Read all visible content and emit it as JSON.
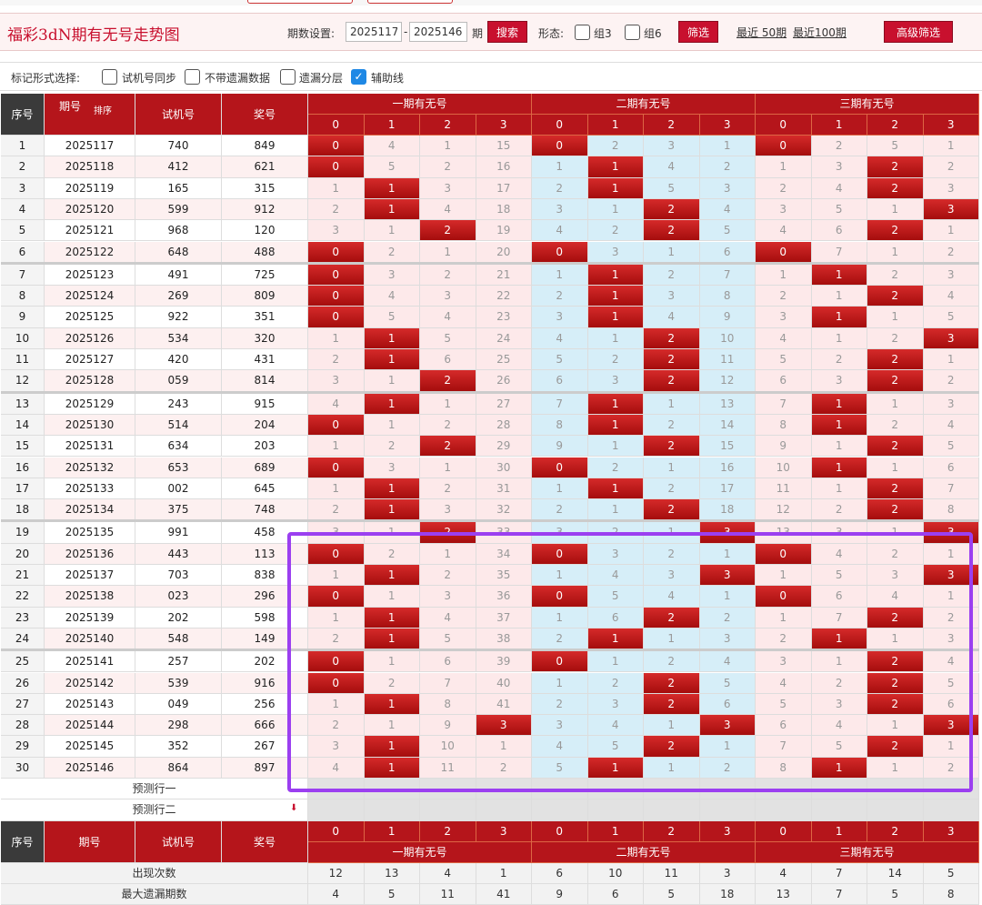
{
  "header": {
    "title": "福彩3dN期有无号走势图",
    "period_setting_label": "期数设置:",
    "period_from": "2025117",
    "period_dash": "-",
    "period_to": "2025146",
    "period_unit": "期",
    "search_button": "搜索",
    "form_label": "形态:",
    "group3_label": "组3",
    "group6_label": "组6",
    "filter_button": "筛选",
    "recent50": "最近 50期",
    "recent100": "最近100期",
    "advanced_button": "高级筛选"
  },
  "mark_options": {
    "label": "标记形式选择:",
    "items": [
      {
        "label": "试机号同步",
        "checked": false
      },
      {
        "label": "不带遗漏数据",
        "checked": false
      },
      {
        "label": "遗漏分层",
        "checked": false
      },
      {
        "label": "辅助线",
        "checked": true
      }
    ]
  },
  "table_header": {
    "seq": "序号",
    "period": "期号",
    "sort": "排序",
    "trial": "试机号",
    "prize": "奖号",
    "groups": [
      "一期有无号",
      "二期有无号",
      "三期有无号"
    ],
    "digits": [
      "0",
      "1",
      "2",
      "3"
    ]
  },
  "rows": [
    {
      "seq": "1",
      "period": "2025117",
      "trial": "740",
      "prize": "849",
      "g": [
        [
          "0",
          "4",
          "1",
          "15"
        ],
        [
          "0",
          "2",
          "3",
          "1"
        ],
        [
          "0",
          "2",
          "5",
          "1"
        ]
      ],
      "h": [
        [
          1,
          0,
          0,
          0
        ],
        [
          1,
          0,
          0,
          0
        ],
        [
          1,
          0,
          0,
          0
        ]
      ]
    },
    {
      "seq": "2",
      "period": "2025118",
      "trial": "412",
      "prize": "621",
      "g": [
        [
          "0",
          "5",
          "2",
          "16"
        ],
        [
          "1",
          "1",
          "4",
          "2"
        ],
        [
          "1",
          "3",
          "2",
          "2"
        ]
      ],
      "h": [
        [
          1,
          0,
          0,
          0
        ],
        [
          0,
          1,
          0,
          0
        ],
        [
          0,
          0,
          1,
          0
        ]
      ]
    },
    {
      "seq": "3",
      "period": "2025119",
      "trial": "165",
      "prize": "315",
      "g": [
        [
          "1",
          "1",
          "3",
          "17"
        ],
        [
          "2",
          "1",
          "5",
          "3"
        ],
        [
          "2",
          "4",
          "2",
          "3"
        ]
      ],
      "h": [
        [
          0,
          1,
          0,
          0
        ],
        [
          0,
          1,
          0,
          0
        ],
        [
          0,
          0,
          1,
          0
        ]
      ]
    },
    {
      "seq": "4",
      "period": "2025120",
      "trial": "599",
      "prize": "912",
      "g": [
        [
          "2",
          "1",
          "4",
          "18"
        ],
        [
          "3",
          "1",
          "2",
          "4"
        ],
        [
          "3",
          "5",
          "1",
          "3"
        ]
      ],
      "h": [
        [
          0,
          1,
          0,
          0
        ],
        [
          0,
          0,
          1,
          0
        ],
        [
          0,
          0,
          0,
          1
        ]
      ]
    },
    {
      "seq": "5",
      "period": "2025121",
      "trial": "968",
      "prize": "120",
      "g": [
        [
          "3",
          "1",
          "2",
          "19"
        ],
        [
          "4",
          "2",
          "2",
          "5"
        ],
        [
          "4",
          "6",
          "2",
          "1"
        ]
      ],
      "h": [
        [
          0,
          0,
          1,
          0
        ],
        [
          0,
          0,
          1,
          0
        ],
        [
          0,
          0,
          1,
          0
        ]
      ]
    },
    {
      "seq": "6",
      "period": "2025122",
      "trial": "648",
      "prize": "488",
      "g": [
        [
          "0",
          "2",
          "1",
          "20"
        ],
        [
          "0",
          "3",
          "1",
          "6"
        ],
        [
          "0",
          "7",
          "1",
          "2"
        ]
      ],
      "h": [
        [
          1,
          0,
          0,
          0
        ],
        [
          1,
          0,
          0,
          0
        ],
        [
          1,
          0,
          0,
          0
        ]
      ]
    },
    {
      "seq": "7",
      "period": "2025123",
      "trial": "491",
      "prize": "725",
      "g": [
        [
          "0",
          "3",
          "2",
          "21"
        ],
        [
          "1",
          "1",
          "2",
          "7"
        ],
        [
          "1",
          "1",
          "2",
          "3"
        ]
      ],
      "h": [
        [
          1,
          0,
          0,
          0
        ],
        [
          0,
          1,
          0,
          0
        ],
        [
          0,
          1,
          0,
          0
        ]
      ]
    },
    {
      "seq": "8",
      "period": "2025124",
      "trial": "269",
      "prize": "809",
      "g": [
        [
          "0",
          "4",
          "3",
          "22"
        ],
        [
          "2",
          "1",
          "3",
          "8"
        ],
        [
          "2",
          "1",
          "2",
          "4"
        ]
      ],
      "h": [
        [
          1,
          0,
          0,
          0
        ],
        [
          0,
          1,
          0,
          0
        ],
        [
          0,
          0,
          1,
          0
        ]
      ]
    },
    {
      "seq": "9",
      "period": "2025125",
      "trial": "922",
      "prize": "351",
      "g": [
        [
          "0",
          "5",
          "4",
          "23"
        ],
        [
          "3",
          "1",
          "4",
          "9"
        ],
        [
          "3",
          "1",
          "1",
          "5"
        ]
      ],
      "h": [
        [
          1,
          0,
          0,
          0
        ],
        [
          0,
          1,
          0,
          0
        ],
        [
          0,
          1,
          0,
          0
        ]
      ]
    },
    {
      "seq": "10",
      "period": "2025126",
      "trial": "534",
      "prize": "320",
      "g": [
        [
          "1",
          "1",
          "5",
          "24"
        ],
        [
          "4",
          "1",
          "2",
          "10"
        ],
        [
          "4",
          "1",
          "2",
          "3"
        ]
      ],
      "h": [
        [
          0,
          1,
          0,
          0
        ],
        [
          0,
          0,
          1,
          0
        ],
        [
          0,
          0,
          0,
          1
        ]
      ]
    },
    {
      "seq": "11",
      "period": "2025127",
      "trial": "420",
      "prize": "431",
      "g": [
        [
          "2",
          "1",
          "6",
          "25"
        ],
        [
          "5",
          "2",
          "2",
          "11"
        ],
        [
          "5",
          "2",
          "2",
          "1"
        ]
      ],
      "h": [
        [
          0,
          1,
          0,
          0
        ],
        [
          0,
          0,
          1,
          0
        ],
        [
          0,
          0,
          1,
          0
        ]
      ]
    },
    {
      "seq": "12",
      "period": "2025128",
      "trial": "059",
      "prize": "814",
      "g": [
        [
          "3",
          "1",
          "2",
          "26"
        ],
        [
          "6",
          "3",
          "2",
          "12"
        ],
        [
          "6",
          "3",
          "2",
          "2"
        ]
      ],
      "h": [
        [
          0,
          0,
          1,
          0
        ],
        [
          0,
          0,
          1,
          0
        ],
        [
          0,
          0,
          1,
          0
        ]
      ]
    },
    {
      "seq": "13",
      "period": "2025129",
      "trial": "243",
      "prize": "915",
      "g": [
        [
          "4",
          "1",
          "1",
          "27"
        ],
        [
          "7",
          "1",
          "1",
          "13"
        ],
        [
          "7",
          "1",
          "1",
          "3"
        ]
      ],
      "h": [
        [
          0,
          1,
          0,
          0
        ],
        [
          0,
          1,
          0,
          0
        ],
        [
          0,
          1,
          0,
          0
        ]
      ]
    },
    {
      "seq": "14",
      "period": "2025130",
      "trial": "514",
      "prize": "204",
      "g": [
        [
          "0",
          "1",
          "2",
          "28"
        ],
        [
          "8",
          "1",
          "2",
          "14"
        ],
        [
          "8",
          "1",
          "2",
          "4"
        ]
      ],
      "h": [
        [
          1,
          0,
          0,
          0
        ],
        [
          0,
          1,
          0,
          0
        ],
        [
          0,
          1,
          0,
          0
        ]
      ]
    },
    {
      "seq": "15",
      "period": "2025131",
      "trial": "634",
      "prize": "203",
      "g": [
        [
          "1",
          "2",
          "2",
          "29"
        ],
        [
          "9",
          "1",
          "2",
          "15"
        ],
        [
          "9",
          "1",
          "2",
          "5"
        ]
      ],
      "h": [
        [
          0,
          0,
          1,
          0
        ],
        [
          0,
          0,
          1,
          0
        ],
        [
          0,
          0,
          1,
          0
        ]
      ]
    },
    {
      "seq": "16",
      "period": "2025132",
      "trial": "653",
      "prize": "689",
      "g": [
        [
          "0",
          "3",
          "1",
          "30"
        ],
        [
          "0",
          "2",
          "1",
          "16"
        ],
        [
          "10",
          "1",
          "1",
          "6"
        ]
      ],
      "h": [
        [
          1,
          0,
          0,
          0
        ],
        [
          1,
          0,
          0,
          0
        ],
        [
          0,
          1,
          0,
          0
        ]
      ]
    },
    {
      "seq": "17",
      "period": "2025133",
      "trial": "002",
      "prize": "645",
      "g": [
        [
          "1",
          "1",
          "2",
          "31"
        ],
        [
          "1",
          "1",
          "2",
          "17"
        ],
        [
          "11",
          "1",
          "2",
          "7"
        ]
      ],
      "h": [
        [
          0,
          1,
          0,
          0
        ],
        [
          0,
          1,
          0,
          0
        ],
        [
          0,
          0,
          1,
          0
        ]
      ]
    },
    {
      "seq": "18",
      "period": "2025134",
      "trial": "375",
      "prize": "748",
      "g": [
        [
          "2",
          "1",
          "3",
          "32"
        ],
        [
          "2",
          "1",
          "2",
          "18"
        ],
        [
          "12",
          "2",
          "2",
          "8"
        ]
      ],
      "h": [
        [
          0,
          1,
          0,
          0
        ],
        [
          0,
          0,
          1,
          0
        ],
        [
          0,
          0,
          1,
          0
        ]
      ]
    },
    {
      "seq": "19",
      "period": "2025135",
      "trial": "991",
      "prize": "458",
      "g": [
        [
          "3",
          "1",
          "2",
          "33"
        ],
        [
          "3",
          "2",
          "1",
          "3"
        ],
        [
          "13",
          "3",
          "1",
          "3"
        ]
      ],
      "h": [
        [
          0,
          0,
          1,
          0
        ],
        [
          0,
          0,
          0,
          1
        ],
        [
          0,
          0,
          0,
          1
        ]
      ]
    },
    {
      "seq": "20",
      "period": "2025136",
      "trial": "443",
      "prize": "113",
      "g": [
        [
          "0",
          "2",
          "1",
          "34"
        ],
        [
          "0",
          "3",
          "2",
          "1"
        ],
        [
          "0",
          "4",
          "2",
          "1"
        ]
      ],
      "h": [
        [
          1,
          0,
          0,
          0
        ],
        [
          1,
          0,
          0,
          0
        ],
        [
          1,
          0,
          0,
          0
        ]
      ]
    },
    {
      "seq": "21",
      "period": "2025137",
      "trial": "703",
      "prize": "838",
      "g": [
        [
          "1",
          "1",
          "2",
          "35"
        ],
        [
          "1",
          "4",
          "3",
          "3"
        ],
        [
          "1",
          "5",
          "3",
          "3"
        ]
      ],
      "h": [
        [
          0,
          1,
          0,
          0
        ],
        [
          0,
          0,
          0,
          1
        ],
        [
          0,
          0,
          0,
          1
        ]
      ]
    },
    {
      "seq": "22",
      "period": "2025138",
      "trial": "023",
      "prize": "296",
      "g": [
        [
          "0",
          "1",
          "3",
          "36"
        ],
        [
          "0",
          "5",
          "4",
          "1"
        ],
        [
          "0",
          "6",
          "4",
          "1"
        ]
      ],
      "h": [
        [
          1,
          0,
          0,
          0
        ],
        [
          1,
          0,
          0,
          0
        ],
        [
          1,
          0,
          0,
          0
        ]
      ]
    },
    {
      "seq": "23",
      "period": "2025139",
      "trial": "202",
      "prize": "598",
      "g": [
        [
          "1",
          "1",
          "4",
          "37"
        ],
        [
          "1",
          "6",
          "2",
          "2"
        ],
        [
          "1",
          "7",
          "2",
          "2"
        ]
      ],
      "h": [
        [
          0,
          1,
          0,
          0
        ],
        [
          0,
          0,
          1,
          0
        ],
        [
          0,
          0,
          1,
          0
        ]
      ]
    },
    {
      "seq": "24",
      "period": "2025140",
      "trial": "548",
      "prize": "149",
      "g": [
        [
          "2",
          "1",
          "5",
          "38"
        ],
        [
          "2",
          "1",
          "1",
          "3"
        ],
        [
          "2",
          "1",
          "1",
          "3"
        ]
      ],
      "h": [
        [
          0,
          1,
          0,
          0
        ],
        [
          0,
          1,
          0,
          0
        ],
        [
          0,
          1,
          0,
          0
        ]
      ]
    },
    {
      "seq": "25",
      "period": "2025141",
      "trial": "257",
      "prize": "202",
      "g": [
        [
          "0",
          "1",
          "6",
          "39"
        ],
        [
          "0",
          "1",
          "2",
          "4"
        ],
        [
          "3",
          "1",
          "2",
          "4"
        ]
      ],
      "h": [
        [
          1,
          0,
          0,
          0
        ],
        [
          1,
          0,
          0,
          0
        ],
        [
          0,
          0,
          1,
          0
        ]
      ]
    },
    {
      "seq": "26",
      "period": "2025142",
      "trial": "539",
      "prize": "916",
      "g": [
        [
          "0",
          "2",
          "7",
          "40"
        ],
        [
          "1",
          "2",
          "2",
          "5"
        ],
        [
          "4",
          "2",
          "2",
          "5"
        ]
      ],
      "h": [
        [
          1,
          0,
          0,
          0
        ],
        [
          0,
          0,
          1,
          0
        ],
        [
          0,
          0,
          1,
          0
        ]
      ]
    },
    {
      "seq": "27",
      "period": "2025143",
      "trial": "049",
      "prize": "256",
      "g": [
        [
          "1",
          "1",
          "8",
          "41"
        ],
        [
          "2",
          "3",
          "2",
          "6"
        ],
        [
          "5",
          "3",
          "2",
          "6"
        ]
      ],
      "h": [
        [
          0,
          1,
          0,
          0
        ],
        [
          0,
          0,
          1,
          0
        ],
        [
          0,
          0,
          1,
          0
        ]
      ]
    },
    {
      "seq": "28",
      "period": "2025144",
      "trial": "298",
      "prize": "666",
      "g": [
        [
          "2",
          "1",
          "9",
          "3"
        ],
        [
          "3",
          "4",
          "1",
          "3"
        ],
        [
          "6",
          "4",
          "1",
          "3"
        ]
      ],
      "h": [
        [
          0,
          0,
          0,
          1
        ],
        [
          0,
          0,
          0,
          1
        ],
        [
          0,
          0,
          0,
          1
        ]
      ]
    },
    {
      "seq": "29",
      "period": "2025145",
      "trial": "352",
      "prize": "267",
      "g": [
        [
          "3",
          "1",
          "10",
          "1"
        ],
        [
          "4",
          "5",
          "2",
          "1"
        ],
        [
          "7",
          "5",
          "2",
          "1"
        ]
      ],
      "h": [
        [
          0,
          1,
          0,
          0
        ],
        [
          0,
          0,
          1,
          0
        ],
        [
          0,
          0,
          1,
          0
        ]
      ]
    },
    {
      "seq": "30",
      "period": "2025146",
      "trial": "864",
      "prize": "897",
      "g": [
        [
          "4",
          "1",
          "11",
          "2"
        ],
        [
          "5",
          "1",
          "1",
          "2"
        ],
        [
          "8",
          "1",
          "1",
          "2"
        ]
      ],
      "h": [
        [
          0,
          1,
          0,
          0
        ],
        [
          0,
          1,
          0,
          0
        ],
        [
          0,
          1,
          0,
          0
        ]
      ]
    }
  ],
  "predict_rows": [
    "预测行一",
    "预测行二"
  ],
  "stats": [
    {
      "label": "出现次数",
      "values": [
        "12",
        "13",
        "4",
        "1",
        "6",
        "10",
        "11",
        "3",
        "4",
        "7",
        "14",
        "5"
      ]
    },
    {
      "label": "最大遗漏期数",
      "values": [
        "4",
        "5",
        "11",
        "41",
        "9",
        "6",
        "5",
        "18",
        "13",
        "7",
        "5",
        "8"
      ]
    }
  ],
  "colors": {
    "accent": "#c8102e",
    "highlight": "#9b3ff0",
    "blue_zone": "#d6eef8",
    "pink_zone": "#fde9ea"
  }
}
